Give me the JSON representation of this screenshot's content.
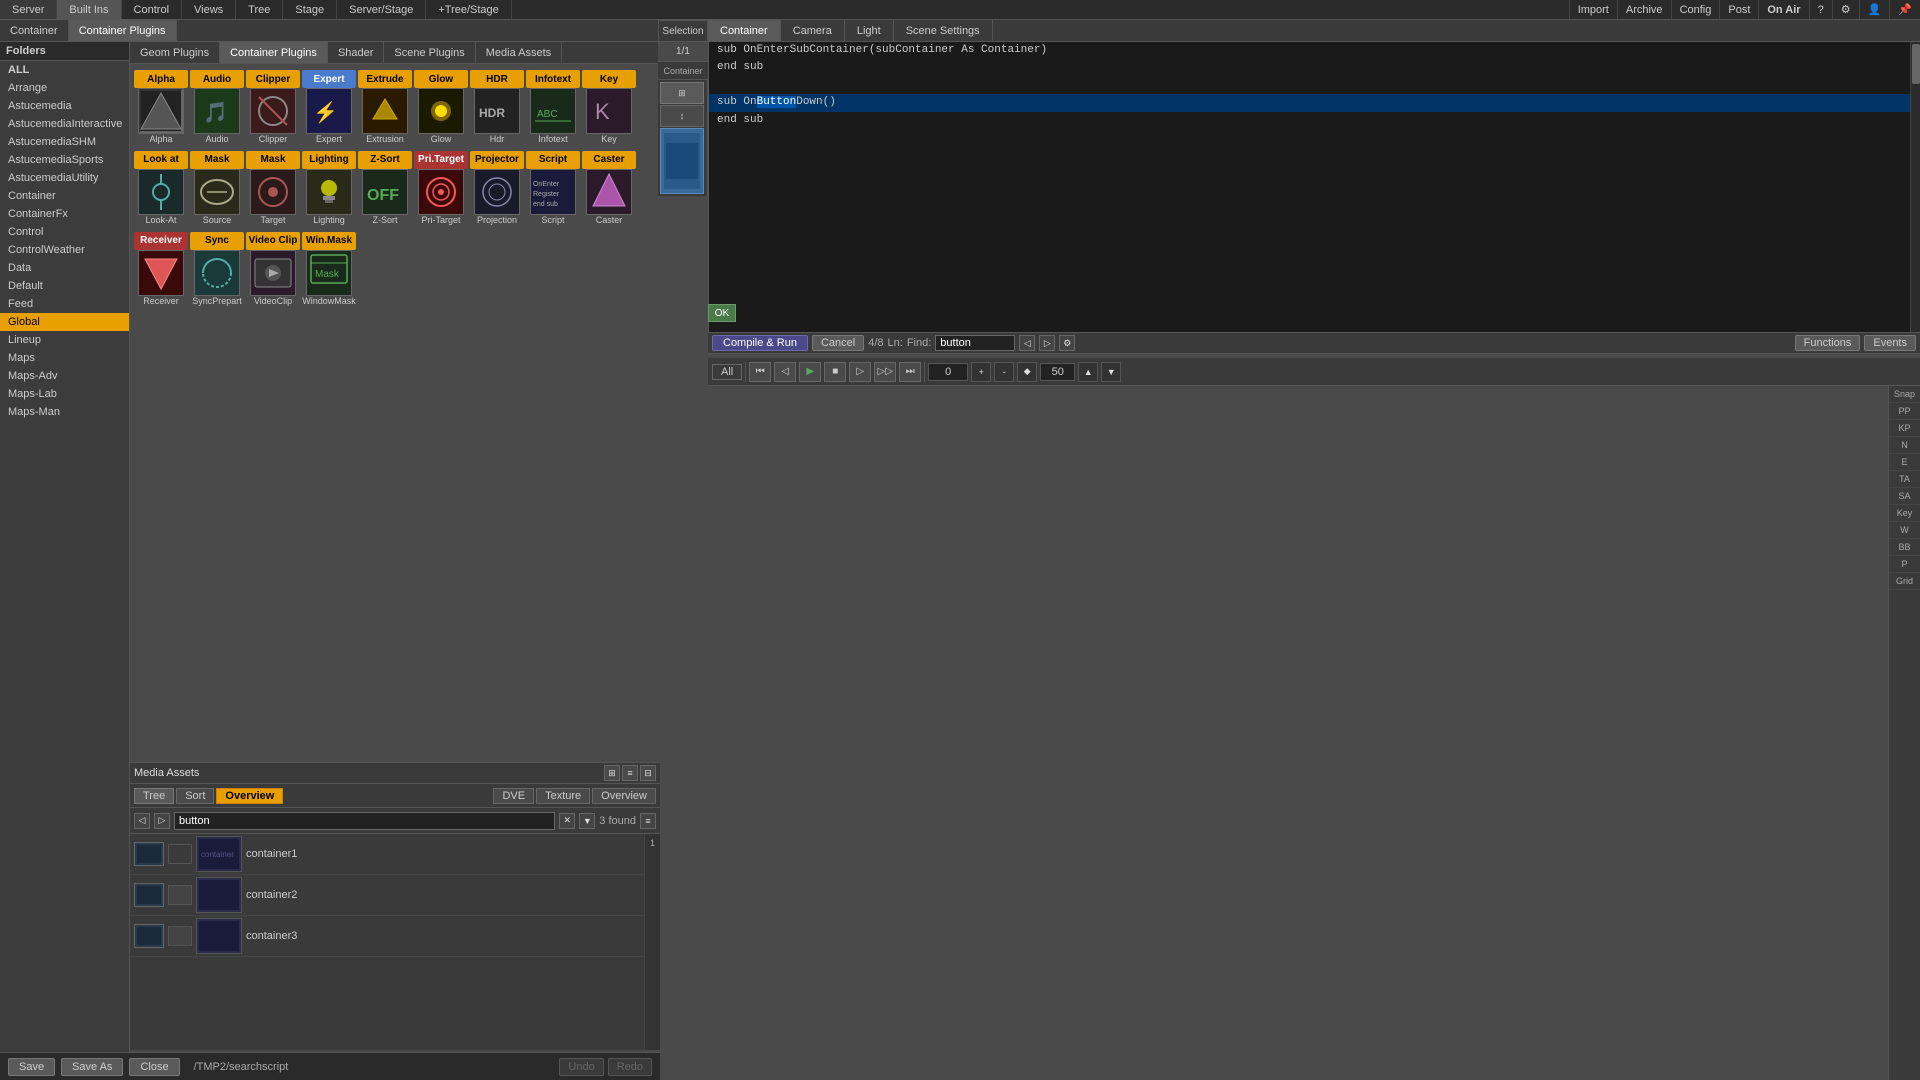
{
  "topbar": {
    "items": [
      "Server",
      "Built Ins",
      "Control",
      "Views",
      "Tree",
      "Stage",
      "Server/Stage",
      "+Tree/Stage"
    ],
    "right_items": [
      "Import",
      "Archive",
      "Config",
      "Post",
      "On Air"
    ],
    "icons": [
      "help-icon",
      "settings-icon",
      "user-icon",
      "pin-icon"
    ]
  },
  "secondary_bar": {
    "tabs": [
      "Container",
      "Container Plugins"
    ]
  },
  "right_panel_tabs": {
    "tabs": [
      "Container",
      "Camera",
      "Light",
      "Scene Settings"
    ]
  },
  "plugin_tabs": {
    "tabs": [
      "Geom Plugins",
      "Container Plugins",
      "Shader",
      "Scene Plugins",
      "Media Assets"
    ]
  },
  "plugins": [
    {
      "label": "Alpha",
      "cat": "orange",
      "icon": "alpha"
    },
    {
      "label": "Audio",
      "cat": "orange",
      "icon": "audio"
    },
    {
      "label": "Clipper",
      "cat": "orange",
      "icon": "clipper"
    },
    {
      "label": "Expert",
      "cat": "blue",
      "icon": "expert"
    },
    {
      "label": "Extrusion",
      "cat": "orange",
      "icon": "extrude"
    },
    {
      "label": "Glow",
      "cat": "orange",
      "icon": "glow"
    },
    {
      "label": "Hdr",
      "cat": "orange",
      "icon": "hdr"
    },
    {
      "label": "Infotext",
      "cat": "orange",
      "icon": "infotext"
    },
    {
      "label": "Key",
      "cat": "orange",
      "icon": "key"
    },
    {
      "label": "Look-At",
      "cat": "orange",
      "icon": "lookat"
    },
    {
      "label": "Source",
      "cat": "orange",
      "icon": "mask-src"
    },
    {
      "label": "Target",
      "cat": "orange",
      "icon": "mask-tgt"
    },
    {
      "label": "Lighting",
      "cat": "orange",
      "icon": "lighting"
    },
    {
      "label": "Z-Sort",
      "cat": "orange",
      "icon": "zsort"
    },
    {
      "label": "Pri-Target",
      "cat": "red",
      "icon": "pritarget"
    },
    {
      "label": "Projection",
      "cat": "orange",
      "icon": "projection"
    },
    {
      "label": "Script",
      "cat": "orange",
      "icon": "script"
    },
    {
      "label": "Caster",
      "cat": "orange",
      "icon": "caster"
    },
    {
      "label": "Receiver",
      "cat": "red",
      "icon": "receiver"
    },
    {
      "label": "SyncPrepart",
      "cat": "orange",
      "icon": "sync"
    },
    {
      "label": "VideoClip",
      "cat": "orange",
      "icon": "videoclip"
    },
    {
      "label": "WindowMask",
      "cat": "orange",
      "icon": "winmask"
    }
  ],
  "plugin_cat_labels": {
    "row1": [
      "Alpha",
      "Audio",
      "Clipper",
      "Expert",
      "Extrude",
      "Glow",
      "HDR",
      "Infotext",
      "Key"
    ],
    "row2_labels": [
      "Look at",
      "Mask",
      "Mask",
      "Lighting",
      "Z-Sort",
      "Pri. Target",
      "Projector",
      "Script",
      "Caster"
    ],
    "row3_labels": [
      "Receiver",
      "Sync",
      "Video Clip",
      "Win.Mask"
    ]
  },
  "folders": {
    "header": "Folders",
    "items": [
      {
        "label": "ALL",
        "bold": true
      },
      {
        "label": "Arrange"
      },
      {
        "label": "Astucemedia"
      },
      {
        "label": "AstucemediaInteractive"
      },
      {
        "label": "AstucemediaSHM"
      },
      {
        "label": "AstucemediaSports"
      },
      {
        "label": "AstucemediaUtility"
      },
      {
        "label": "Container"
      },
      {
        "label": "ContainerFx"
      },
      {
        "label": "Control"
      },
      {
        "label": "ControlWeather"
      },
      {
        "label": "Data"
      },
      {
        "label": "Default"
      },
      {
        "label": "Feed"
      },
      {
        "label": "Global",
        "selected": true
      },
      {
        "label": "Lineup"
      },
      {
        "label": "Maps"
      },
      {
        "label": "Maps-Adv"
      },
      {
        "label": "Maps-Lab"
      },
      {
        "label": "Maps-Man"
      }
    ]
  },
  "media_assets": {
    "title": "Media Assets",
    "tabs": [
      "DVE",
      "Texture",
      "Overview"
    ],
    "search_placeholder": "button",
    "found_count": "3 found",
    "results": [
      {
        "name": "container1"
      },
      {
        "name": "container2"
      },
      {
        "name": "container3"
      }
    ]
  },
  "script_editor": {
    "lines": [
      "sub OnEnterSubContainer(subContainer As Container)",
      "end sub",
      "",
      "sub OnButtonDown()",
      "end sub"
    ],
    "find_value": "button",
    "match_info": "4/8",
    "ln_value": ""
  },
  "editor_toolbar": {
    "ok_label": "OK",
    "compile_label": "Compile & Run",
    "cancel_label": "Cancel",
    "ln_label": "Ln:",
    "find_label": "Find:",
    "functions_label": "Functions",
    "events_label": "Events"
  },
  "transport": {
    "all_label": "All",
    "position": "0",
    "time_value": "50",
    "controls": [
      "⏮",
      "⏭",
      "⏸",
      "▶",
      "⏹",
      "⏭",
      "⏭⏭",
      "⏯"
    ]
  },
  "bottom_toolbar": {
    "save_label": "Save",
    "save_as_label": "Save As",
    "close_label": "Close",
    "path": "/TMP2/searchscript",
    "undo_label": "Undo",
    "redo_label": "Redo"
  },
  "selection_bar": {
    "header": "Selection",
    "sub": "1/1",
    "sub2": "Container"
  },
  "snap_labels": [
    "Snap",
    "PP",
    "KP",
    "N",
    "E",
    "TA",
    "SA",
    "Key",
    "W",
    "BB",
    "P",
    "Grid"
  ],
  "viewport": {
    "bg": "#000000"
  }
}
